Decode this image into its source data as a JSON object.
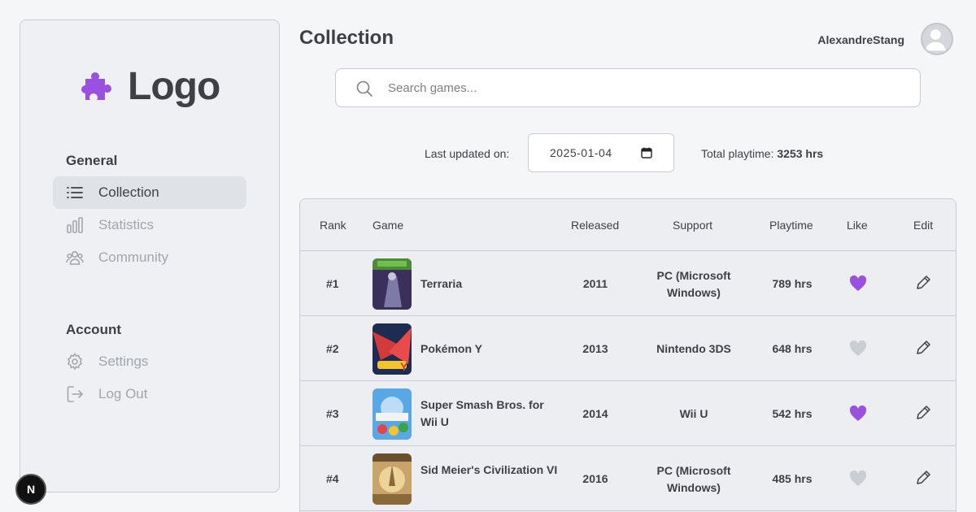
{
  "brand": {
    "logo_text": "Logo",
    "accent": "#9b51e0"
  },
  "sidebar": {
    "general_title": "General",
    "account_title": "Account",
    "items": [
      {
        "label": "Collection",
        "icon": "list-icon",
        "active": true
      },
      {
        "label": "Statistics",
        "icon": "bar-chart-icon",
        "active": false
      },
      {
        "label": "Community",
        "icon": "users-icon",
        "active": false
      },
      {
        "label": "Settings",
        "icon": "gear-icon",
        "active": false
      },
      {
        "label": "Log Out",
        "icon": "logout-icon",
        "active": false
      }
    ]
  },
  "header": {
    "title": "Collection",
    "username": "AlexandreStang"
  },
  "search": {
    "placeholder": "Search games...",
    "value": ""
  },
  "filters": {
    "last_updated_label": "Last updated on:",
    "date_value": "2025-01-04",
    "total_playtime_label": "Total playtime:",
    "total_playtime_value": "3253 hrs"
  },
  "table": {
    "columns": [
      "Rank",
      "Game",
      "Released",
      "Support",
      "Playtime",
      "Like",
      "Edit"
    ],
    "rows": [
      {
        "rank": "#1",
        "game": "Terraria",
        "released": "2011",
        "support": "PC (Microsoft Windows)",
        "playtime": "789 hrs",
        "liked": true
      },
      {
        "rank": "#2",
        "game": "Pokémon Y",
        "released": "2013",
        "support": "Nintendo 3DS",
        "playtime": "648 hrs",
        "liked": false
      },
      {
        "rank": "#3",
        "game": "Super Smash Bros. for Wii U",
        "released": "2014",
        "support": "Wii U",
        "playtime": "542 hrs",
        "liked": true
      },
      {
        "rank": "#4",
        "game": "Sid Meier's Civilization VI",
        "released": "2016",
        "support": "PC (Microsoft Windows)",
        "playtime": "485 hrs",
        "liked": false
      }
    ]
  },
  "badge": {
    "letter": "N"
  },
  "colors": {
    "liked": "#9b51e0",
    "unliked": "#c9ced4"
  }
}
